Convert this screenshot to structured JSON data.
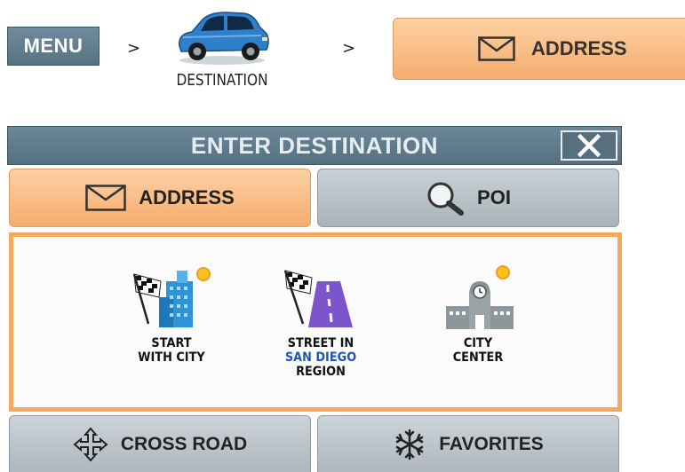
{
  "breadcrumb": {
    "menu_label": "MENU",
    "separator": ">",
    "destination_label": "DESTINATION",
    "address_label": "ADDRESS"
  },
  "header": {
    "title": "ENTER DESTINATION",
    "close_icon": "close-icon"
  },
  "tabs": [
    {
      "label": "ADDRESS",
      "icon": "envelope-icon",
      "active": true
    },
    {
      "label": "POI",
      "icon": "magnifier-icon",
      "active": false
    }
  ],
  "options": [
    {
      "line1": "START",
      "line2": "WITH CITY",
      "icon": "city-flag-icon"
    },
    {
      "line1": "STREET IN",
      "line2": "SAN DIEGO",
      "line3": "REGION",
      "icon": "street-flag-icon"
    },
    {
      "line1": "CITY",
      "line2": "CENTER",
      "icon": "city-center-icon"
    }
  ],
  "bottom_buttons": [
    {
      "label": "CROSS ROAD",
      "icon": "cross-arrows-icon"
    },
    {
      "label": "FAVORITES",
      "icon": "snowflake-icon"
    }
  ],
  "colors": {
    "accent_orange": "#f6ac6e",
    "header_slate": "#557181",
    "region_blue": "#1e56b5"
  }
}
